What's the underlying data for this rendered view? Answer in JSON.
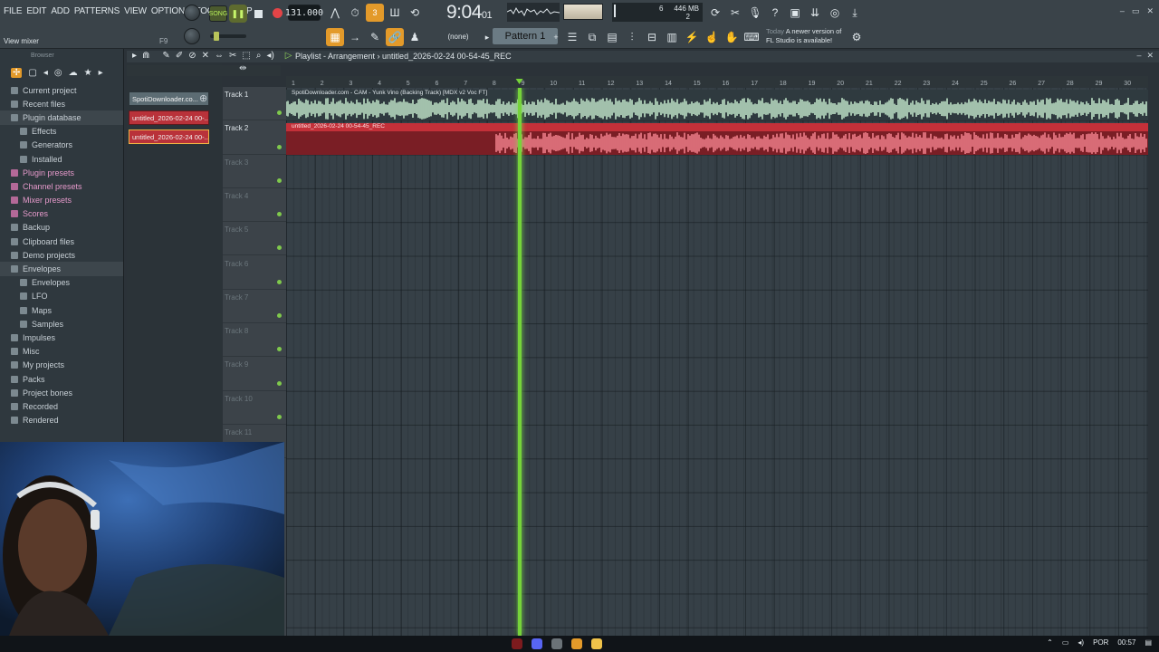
{
  "menu": [
    "FILE",
    "EDIT",
    "ADD",
    "PATTERNS",
    "VIEW",
    "OPTIONS",
    "TOOLS",
    "HELP"
  ],
  "hint": {
    "text": "View mixer",
    "key": "F9"
  },
  "transport": {
    "song_label": "SONG",
    "tempo": "131.000",
    "time_main": "9:04",
    "time_sub": "01"
  },
  "cpu": {
    "cores": "6",
    "memory": "446 MB",
    "polyphony": "2"
  },
  "toolbar": {
    "pattern_mode": "(none)",
    "pattern_name": "Pattern 1"
  },
  "news": {
    "today": "Today",
    "line1": "A newer version of",
    "line2": "FL Studio is available!"
  },
  "browser": {
    "title": "Browser",
    "items": [
      {
        "label": "Current project",
        "indent": 0,
        "style": "normal"
      },
      {
        "label": "Recent files",
        "indent": 0,
        "style": "normal"
      },
      {
        "label": "Plugin database",
        "indent": 0,
        "style": "sel"
      },
      {
        "label": "Effects",
        "indent": 1,
        "style": "normal"
      },
      {
        "label": "Generators",
        "indent": 1,
        "style": "normal"
      },
      {
        "label": "Installed",
        "indent": 1,
        "style": "normal"
      },
      {
        "label": "Plugin presets",
        "indent": 0,
        "style": "hl"
      },
      {
        "label": "Channel presets",
        "indent": 0,
        "style": "hl"
      },
      {
        "label": "Mixer presets",
        "indent": 0,
        "style": "hl"
      },
      {
        "label": "Scores",
        "indent": 0,
        "style": "hl"
      },
      {
        "label": "Backup",
        "indent": 0,
        "style": "normal"
      },
      {
        "label": "Clipboard files",
        "indent": 0,
        "style": "normal"
      },
      {
        "label": "Demo projects",
        "indent": 0,
        "style": "normal"
      },
      {
        "label": "Envelopes",
        "indent": 0,
        "style": "sel"
      },
      {
        "label": "Envelopes",
        "indent": 1,
        "style": "normal"
      },
      {
        "label": "LFO",
        "indent": 1,
        "style": "normal"
      },
      {
        "label": "Maps",
        "indent": 1,
        "style": "normal"
      },
      {
        "label": "Samples",
        "indent": 1,
        "style": "normal"
      },
      {
        "label": "Impulses",
        "indent": 0,
        "style": "normal"
      },
      {
        "label": "Misc",
        "indent": 0,
        "style": "normal"
      },
      {
        "label": "My projects",
        "indent": 0,
        "style": "normal"
      },
      {
        "label": "Packs",
        "indent": 0,
        "style": "normal"
      },
      {
        "label": "Project bones",
        "indent": 0,
        "style": "normal"
      },
      {
        "label": "Recorded",
        "indent": 0,
        "style": "normal"
      },
      {
        "label": "Rendered",
        "indent": 0,
        "style": "normal"
      }
    ]
  },
  "playlist": {
    "title": "Playlist - Arrangement",
    "project": "untitled_2026-02-24 00-54-45_REC",
    "pattern_clips": [
      "SpotiDownloader.co...",
      "untitled_2026-02-24 00-...",
      "untitled_2026-02-24 00-..."
    ],
    "tracks": [
      "Track 1",
      "Track 2",
      "Track 3",
      "Track 4",
      "Track 5",
      "Track 6",
      "Track 7",
      "Track 8",
      "Track 9",
      "Track 10",
      "Track 11"
    ],
    "bars": [
      1,
      2,
      3,
      4,
      5,
      6,
      7,
      8,
      9,
      10,
      11,
      12,
      13,
      14,
      15,
      16,
      17,
      18,
      19,
      20,
      21,
      22,
      23,
      24,
      25,
      26,
      27,
      28,
      29,
      30
    ],
    "clip1_label": "SpotiDownloader.com - CAM - Yunk Vino (Backing Track) [MDX v2 Voc FT]",
    "clip2_label": "untitled_2026-02-24 00-54-45_REC",
    "playhead_bar": 9
  },
  "taskbar": {
    "lang": "POR",
    "clock": "00:57"
  },
  "colors": {
    "accent": "#76d33a",
    "clip_red": "#c43039",
    "clip_wave_green": "#bfe3c8",
    "clip_wave_red": "#f07f8b",
    "hint_pink": "#e69acb"
  }
}
